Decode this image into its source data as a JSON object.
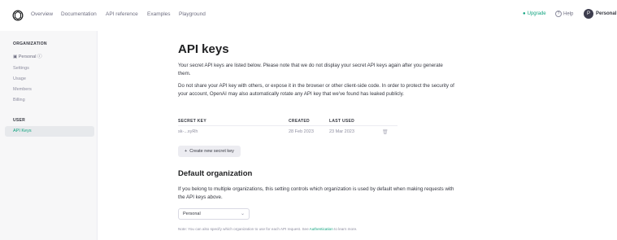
{
  "topnav": {
    "links": [
      "Overview",
      "Documentation",
      "API reference",
      "Examples",
      "Playground"
    ],
    "upgrade_label": "Upgrade",
    "help_label": "Help",
    "avatar_initial": "P",
    "user_label": "Personal",
    "icons": {
      "logo": "openai-logo-icon",
      "help": "help-circle-icon",
      "upgrade": "star-icon"
    }
  },
  "sidebar": {
    "org_title": "ORGANIZATION",
    "org_selected": "Personal",
    "org_items": [
      "Settings",
      "Usage",
      "Members",
      "Billing"
    ],
    "user_title": "USER",
    "user_items": [
      "API Keys"
    ]
  },
  "main": {
    "title": "API keys",
    "intro": "Your secret API keys are listed below. Please note that we do not display your secret API keys again after you generate them.",
    "warning": "Do not share your API key with others, or expose it in the browser or other client-side code. In order to protect the security of your account, OpenAI may also automatically rotate any API key that we've found has leaked publicly.",
    "table": {
      "headers": [
        "SECRET KEY",
        "CREATED",
        "LAST USED"
      ],
      "rows": [
        {
          "secret_key": "sk-...xyRh",
          "created": "28 Feb 2023",
          "last_used": "23 Mar 2023"
        }
      ]
    },
    "create_button": "Create new secret key",
    "default_org_title": "Default organization",
    "default_org_desc": "If you belong to multiple organizations, this setting controls which organization is used by default when making requests with the API keys above.",
    "select_value": "Personal",
    "note_prefix": "Note: You can also specify which organization to use for each API request. See ",
    "note_link": "Authentication",
    "note_suffix": " to learn more."
  },
  "colors": {
    "accent": "#10a37f",
    "sidebar_bg": "#f7f7f8",
    "active_bg": "#e7e9ec"
  }
}
